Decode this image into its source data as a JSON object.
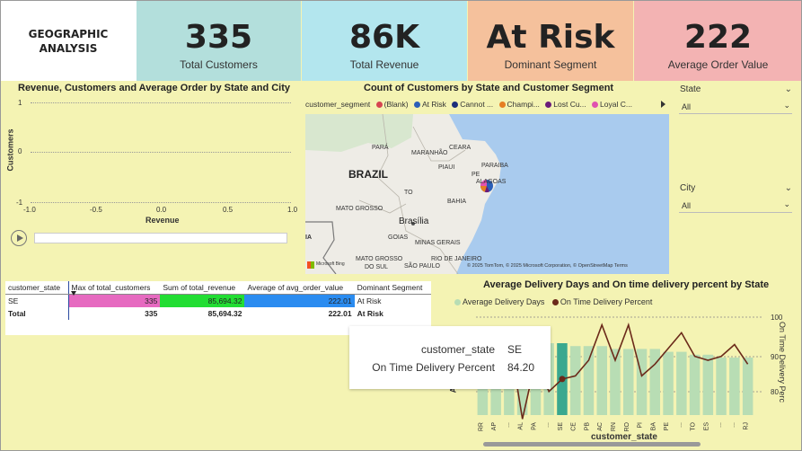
{
  "header": {
    "title_line1": "GEOGRAPHIC",
    "title_line2": "ANALYSIS"
  },
  "kpis": [
    {
      "value": "335",
      "label": "Total Customers",
      "color": "#b3dfdc"
    },
    {
      "value": "86K",
      "label": "Total Revenue",
      "color": "#b3e6ee"
    },
    {
      "value": "At Risk",
      "label": "Dominant Segment",
      "color": "#f5c19c"
    },
    {
      "value": "222",
      "label": "Average Order Value",
      "color": "#f3b3b3"
    }
  ],
  "scatter": {
    "title": "Revenue, Customers and Average Order by State and City",
    "ylabel": "Customers",
    "xlabel": "Revenue",
    "yticks": [
      "1",
      "0",
      "-1"
    ],
    "xticks": [
      "-1.0",
      "-0.5",
      "0.0",
      "0.5",
      "1.0"
    ]
  },
  "map": {
    "title": "Count of Customers by State and Customer Segment",
    "legend_label": "customer_segment",
    "legend": [
      {
        "name": "(Blank)",
        "color": "#d64550"
      },
      {
        "name": "At Risk",
        "color": "#2b5fb8"
      },
      {
        "name": "Cannot ...",
        "color": "#1c2f7a"
      },
      {
        "name": "Champi...",
        "color": "#e67e22"
      },
      {
        "name": "Lost Cu...",
        "color": "#6a1b7a"
      },
      {
        "name": "Loyal C...",
        "color": "#e052b0"
      }
    ],
    "labels": {
      "country": "BRAZIL",
      "para": "PARÁ",
      "maranhao": "MARANHÃO",
      "ceara": "CEARA",
      "piaui": "PIAUI",
      "pe": "PE",
      "paraiba": "PARAIBA",
      "alagoas": "ALAGOAS",
      "to": "TO",
      "bahia": "BAHIA",
      "mato_grosso": "MATO GROSSO",
      "brasilia": "Brasília",
      "goias": "GOIAS",
      "minas": "MINAS GERAIS",
      "mato_grosso_sul": "MATO GROSSO",
      "do_sul": "DO SUL",
      "sao_paulo": "SÃO PAULO",
      "rio": "RIO DE JANEIRO",
      "edge": "IA"
    },
    "attribution": "© 2025 TomTom, © 2025 Microsoft Corporation, © OpenStreetMap  Terms",
    "ms_logo": "Microsoft Bing"
  },
  "slicers": [
    {
      "label": "State",
      "value": "All"
    },
    {
      "label": "City",
      "value": "All"
    }
  ],
  "table": {
    "headers": [
      "customer_state",
      "Max of total_customers",
      "Sum of total_revenue",
      "Average of avg_order_value",
      "Dominant Segment"
    ],
    "rows": [
      [
        "SE",
        "335",
        "85,694.32",
        "222.01",
        "At Risk"
      ]
    ],
    "total": [
      "Total",
      "335",
      "85,694.32",
      "222.01",
      "At Risk"
    ]
  },
  "combo": {
    "title": "Average Delivery Days and On time delivery percent by State",
    "legend_bar": "Average Delivery Days",
    "legend_line": "On Time Delivery Percent",
    "ylabel_left": "Avera",
    "ylabel_right": "On Time Delivery Perc",
    "xlabel": "customer_state",
    "y2ticks": [
      "100",
      "90",
      "80"
    ],
    "colors": {
      "bar": "#b8ddb4",
      "bar_selected": "#3aa88f",
      "line": "#6b2a1a"
    }
  },
  "chart_data": {
    "type": "bar",
    "categories": [
      "RR",
      "AP",
      "",
      "AL",
      "PA",
      "",
      "SE",
      "CE",
      "PB",
      "AC",
      "RN",
      "RO",
      "PI",
      "BA",
      "PE",
      "",
      "TO",
      "ES",
      "",
      "",
      "RJ"
    ],
    "series": [
      {
        "name": "Average Delivery Days",
        "values": [
          28,
          28,
          27,
          25,
          25,
          25,
          25,
          24,
          24,
          24,
          23,
          23,
          23,
          23,
          22,
          22,
          21,
          21,
          20,
          20,
          20
        ]
      },
      {
        "name": "On Time Delivery Percent",
        "values": [
          94,
          89,
          95,
          74,
          89,
          81,
          84.2,
          85,
          89,
          98,
          89,
          98,
          85,
          88,
          92,
          96,
          90,
          89,
          90,
          93,
          88
        ]
      }
    ],
    "y2lim": [
      75,
      100
    ]
  },
  "tooltip": {
    "key1": "customer_state",
    "val1": "SE",
    "key2": "On Time Delivery Percent",
    "val2": "84.20"
  }
}
